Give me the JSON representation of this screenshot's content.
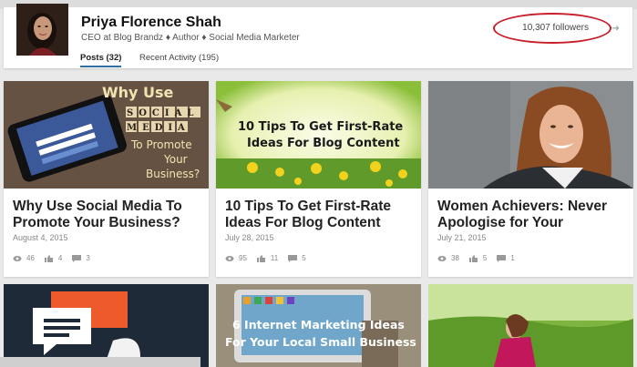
{
  "profile": {
    "name": "Priya Florence Shah",
    "headline": "CEO at Blog Brandz ♦ Author ♦ Social Media Marketer",
    "followers": "10,307 followers"
  },
  "tabs": [
    "Posts (32)",
    "Recent Activity (195)"
  ],
  "posts": [
    {
      "image_text": [
        "Why Use",
        "SOCIAL",
        "MEDIA",
        "To Promote",
        "Your",
        "Business?"
      ],
      "title_line1": "Why Use Social Media To",
      "title_line2": "Promote Your Business?",
      "date": "August 4, 2015",
      "views": "46",
      "likes": "4",
      "comments": "3"
    },
    {
      "image_text": [
        "10 Tips To Get First-Rate",
        "Ideas For Blog Content"
      ],
      "title_line1": "10 Tips To Get First-Rate",
      "title_line2": "Ideas For Blog Content",
      "date": "July 28, 2015",
      "views": "95",
      "likes": "11",
      "comments": "5"
    },
    {
      "image_text": [],
      "title_line1": "Women Achievers: Never",
      "title_line2": "Apologise for Your",
      "date": "July 21, 2015",
      "views": "38",
      "likes": "5",
      "comments": "1"
    }
  ],
  "bottom_posts": [
    {
      "image_text": []
    },
    {
      "image_text": [
        "6 Internet Marketing Ideas",
        "For Your Local Small Business"
      ]
    },
    {
      "image_text": []
    }
  ],
  "colors": {
    "accent": "#2f6fa6",
    "highlight": "#c81e2a",
    "fb_blue": "#3b5998"
  }
}
